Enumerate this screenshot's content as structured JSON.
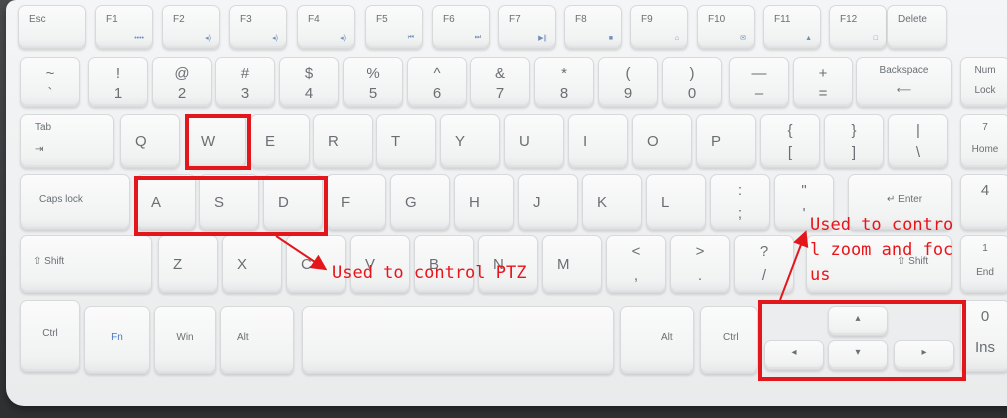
{
  "keyboard": {
    "row_fn": [
      {
        "label": "Esc"
      },
      {
        "label": "F1",
        "sub": "••••"
      },
      {
        "label": "F2",
        "sub": "◂)"
      },
      {
        "label": "F3",
        "sub": "◂)"
      },
      {
        "label": "F4",
        "sub": "◂)"
      },
      {
        "label": "F5",
        "sub": "⏮"
      },
      {
        "label": "F6",
        "sub": "⏭"
      },
      {
        "label": "F7",
        "sub": "▶∥"
      },
      {
        "label": "F8",
        "sub": "■"
      },
      {
        "label": "F9",
        "sub": "⌂"
      },
      {
        "label": "F10",
        "sub": "✉"
      },
      {
        "label": "F11",
        "sub": "▲"
      },
      {
        "label": "F12",
        "sub": "□"
      },
      {
        "label": "Delete"
      }
    ],
    "row_num": [
      {
        "top": "~",
        "bottom": "`"
      },
      {
        "top": "!",
        "bottom": "1"
      },
      {
        "top": "@",
        "bottom": "2"
      },
      {
        "top": "#",
        "bottom": "3"
      },
      {
        "top": "$",
        "bottom": "4"
      },
      {
        "top": "%",
        "bottom": "5"
      },
      {
        "top": "^",
        "bottom": "6"
      },
      {
        "top": "&",
        "bottom": "7"
      },
      {
        "top": "*",
        "bottom": "8"
      },
      {
        "top": "(",
        "bottom": "9"
      },
      {
        "top": ")",
        "bottom": "0"
      },
      {
        "top": "—",
        "bottom": "–"
      },
      {
        "top": "+",
        "bottom": "="
      },
      {
        "top": "Backspace",
        "bottom": "⟵"
      },
      {
        "top": "Num",
        "bottom": "Lock"
      }
    ],
    "row_q": [
      {
        "top": "Tab",
        "bottom": "⇥"
      },
      {
        "label": "Q"
      },
      {
        "label": "W"
      },
      {
        "label": "E"
      },
      {
        "label": "R"
      },
      {
        "label": "T"
      },
      {
        "label": "Y"
      },
      {
        "label": "U"
      },
      {
        "label": "I"
      },
      {
        "label": "O"
      },
      {
        "label": "P"
      },
      {
        "top": "{",
        "bottom": "["
      },
      {
        "top": "}",
        "bottom": "]"
      },
      {
        "top": "|",
        "bottom": "\\"
      },
      {
        "top": "7",
        "bottom": "Home"
      }
    ],
    "row_a": [
      {
        "label": "Caps lock"
      },
      {
        "label": "A"
      },
      {
        "label": "S"
      },
      {
        "label": "D"
      },
      {
        "label": "F"
      },
      {
        "label": "G"
      },
      {
        "label": "H"
      },
      {
        "label": "J"
      },
      {
        "label": "K"
      },
      {
        "label": "L"
      },
      {
        "top": ":",
        "bottom": ";"
      },
      {
        "top": "\"",
        "bottom": "'"
      },
      {
        "label": "↵ Enter"
      },
      {
        "top": "4",
        "bottom": ""
      }
    ],
    "row_z": [
      {
        "label": "⇧ Shift"
      },
      {
        "label": "Z"
      },
      {
        "label": "X"
      },
      {
        "label": "C"
      },
      {
        "label": "V"
      },
      {
        "label": "B"
      },
      {
        "label": "N"
      },
      {
        "label": "M"
      },
      {
        "top": "<",
        "bottom": ","
      },
      {
        "top": ">",
        "bottom": "."
      },
      {
        "top": "?",
        "bottom": "/"
      },
      {
        "label": "⇧ Shift"
      },
      {
        "top": "1",
        "bottom": "End"
      }
    ],
    "row_bottom": [
      {
        "label": "Ctrl"
      },
      {
        "label": "Fn"
      },
      {
        "label": "Win"
      },
      {
        "label": "Alt"
      },
      {
        "label": ""
      },
      {
        "label": "Alt"
      },
      {
        "label": "Ctrl"
      },
      {
        "label": "◂"
      },
      {
        "label": "▴"
      },
      {
        "label": "▾"
      },
      {
        "label": "▸"
      },
      {
        "top": "0",
        "bottom": "Ins"
      }
    ]
  },
  "annotations": {
    "ptz": "Used to control PTZ",
    "zoom_lines": [
      "Used to contro",
      "l zoom and foc",
      "us"
    ],
    "color": "#e3161b"
  }
}
